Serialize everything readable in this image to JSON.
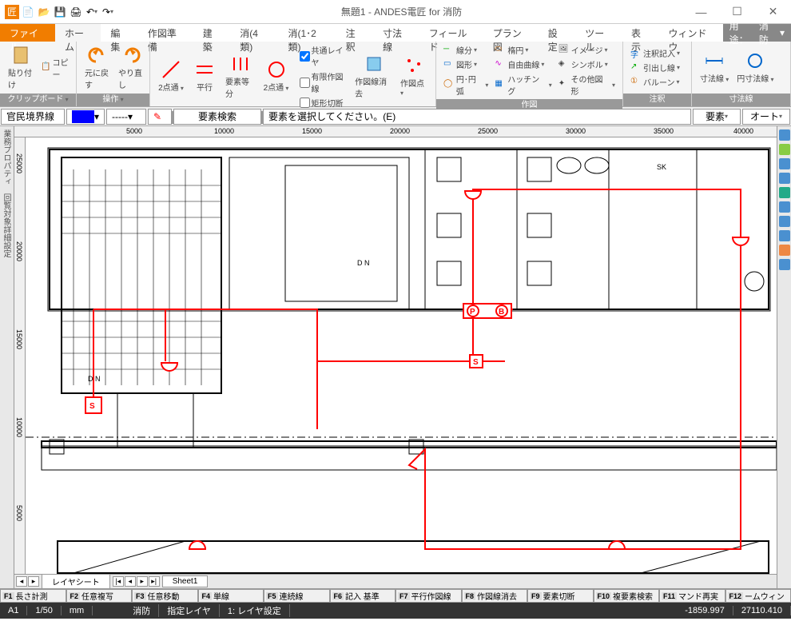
{
  "titlebar": {
    "title": "無題1 - ANDES電匠 for 消防"
  },
  "menu": {
    "file": "ファイル",
    "tabs": [
      "ホーム",
      "編集",
      "作図準備",
      "建築",
      "消(4類)",
      "消(1･2類)",
      "注釈",
      "寸法線",
      "フィールド",
      "プラン図",
      "設定",
      "ツール",
      "表示",
      "ウィンドウ"
    ],
    "active_index": 0,
    "usage_label": "用途：",
    "usage_value": "消防"
  },
  "ribbon": {
    "groups": {
      "clipboard": {
        "label": "クリップボード",
        "paste": "貼り付け",
        "copy": "コピー"
      },
      "operate": {
        "label": "操作",
        "undo": "元に戻す",
        "redo": "やり直し"
      },
      "drawaid": {
        "label": "作図補助",
        "twopt": "2点通",
        "parallel": "平行",
        "equally": "要素等分",
        "twopt2": "2点通",
        "common_layer": "共通レイヤ",
        "limited_line": "有限作図線",
        "rect_cut": "矩形切断",
        "erase_line": "作図線消去",
        "draw_point": "作図点"
      },
      "draw": {
        "label": "作図",
        "segment": "線分",
        "shape": "図形",
        "circle_arc": "円･円弧",
        "ellipse": "楕円",
        "freecurve": "自由曲線",
        "hatch": "ハッチング",
        "image": "イメージ",
        "symbol": "シンボル",
        "other": "その他図形"
      },
      "annot": {
        "label": "注釈",
        "text": "注釈記入",
        "leader": "引出し線",
        "balloon": "バルーン"
      },
      "dim": {
        "label": "寸法線",
        "dim": "寸法線",
        "circdim": "円寸法線"
      }
    }
  },
  "optionbar": {
    "layer_name": "官民境界線",
    "search": "要素検索",
    "prompt": "要素を選択してください。(E)",
    "element": "要素",
    "auto": "オート"
  },
  "ruler_h": [
    "5000",
    "10000",
    "15000",
    "20000",
    "25000",
    "30000",
    "35000",
    "40000"
  ],
  "ruler_v": [
    "25000",
    "20000",
    "15000",
    "10000",
    "5000"
  ],
  "drawing": {
    "symbols": {
      "p": "P",
      "b": "B",
      "s1": "S",
      "s2": "S",
      "sk": "SK",
      "dn1": "D N",
      "dn2": "D N"
    }
  },
  "leftpanels": [
    "業務プロパティ",
    "回覧対象詳細設定"
  ],
  "sheetbar": {
    "layersheet": "レイヤシート",
    "sheet1": "Sheet1"
  },
  "fnkeys": [
    {
      "k": "F1",
      "t": "長さ計測"
    },
    {
      "k": "F2",
      "t": "任意複写"
    },
    {
      "k": "F3",
      "t": "任意移動"
    },
    {
      "k": "F4",
      "t": "単線"
    },
    {
      "k": "F5",
      "t": "連続線"
    },
    {
      "k": "F6",
      "t": "記入 基準"
    },
    {
      "k": "F7",
      "t": "平行作図線"
    },
    {
      "k": "F8",
      "t": "作図線消去"
    },
    {
      "k": "F9",
      "t": "要素切断"
    },
    {
      "k": "F10",
      "t": "複要素検索"
    },
    {
      "k": "F11",
      "t": "マンド再実"
    },
    {
      "k": "F12",
      "t": "ームウィン"
    }
  ],
  "statusbar": {
    "paper": "A1",
    "scale": "1/50",
    "unit": "mm",
    "mode": "消防",
    "layer": "指定レイヤ",
    "layer_no": "1:",
    "layer_name": "レイヤ設定",
    "x": "-1859.997",
    "y": "27110.410"
  }
}
